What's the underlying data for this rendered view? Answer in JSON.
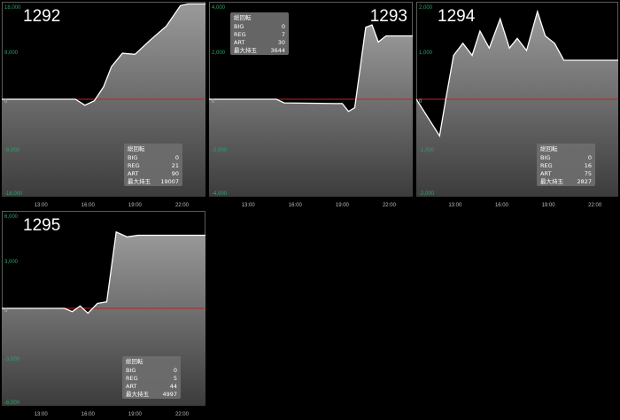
{
  "chart_data": [
    {
      "type": "area",
      "title": "1292",
      "x_ticks": [
        "13:00",
        "16:00",
        "19:00",
        "22:00"
      ],
      "x_tick_values": [
        13,
        16,
        19,
        22
      ],
      "xlim": [
        10.5,
        23.5
      ],
      "ylim": [
        -18000,
        18000
      ],
      "y_ticks": [
        18000,
        9000,
        0,
        -9000,
        -18000
      ],
      "y_tick_labels": [
        "18,000",
        "9,000",
        "0",
        "-9,000",
        "-18,000"
      ],
      "x": [
        10.5,
        15.2,
        15.8,
        16.4,
        17.0,
        17.5,
        18.2,
        19.0,
        20.0,
        21.0,
        21.9,
        22.4,
        23.5
      ],
      "y": [
        0,
        0,
        -1100,
        -300,
        2300,
        6000,
        8500,
        8300,
        11000,
        13500,
        17300,
        17600,
        17600
      ],
      "stats": {
        "heading": "総回転",
        "rows": [
          [
            "BIG",
            "0"
          ],
          [
            "REG",
            "21"
          ],
          [
            "ART",
            "90"
          ],
          [
            "最大持玉",
            "19007"
          ]
        ]
      }
    },
    {
      "type": "area",
      "title": "1293",
      "x_ticks": [
        "13:00",
        "16:00",
        "19:00",
        "22:00"
      ],
      "x_tick_values": [
        13,
        16,
        19,
        22
      ],
      "xlim": [
        10.5,
        23.5
      ],
      "ylim": [
        -4000,
        4000
      ],
      "y_ticks": [
        4000,
        2000,
        0,
        -2000,
        -4000
      ],
      "y_tick_labels": [
        "4,000",
        "2,000",
        "0",
        "-2,000",
        "-4,000"
      ],
      "x": [
        10.5,
        14.8,
        15.3,
        19.0,
        19.4,
        19.8,
        20.5,
        20.9,
        21.3,
        21.8,
        22.4,
        23.5
      ],
      "y": [
        0,
        0,
        -150,
        -180,
        -500,
        -350,
        2950,
        3050,
        2350,
        2600,
        2600,
        2600
      ],
      "stats": {
        "heading": "総回転",
        "rows": [
          [
            "BIG",
            "0"
          ],
          [
            "REG",
            "7"
          ],
          [
            "ART",
            "30"
          ],
          [
            "最大持玉",
            "3644"
          ]
        ]
      }
    },
    {
      "type": "area",
      "title": "1294",
      "x_ticks": [
        "13:00",
        "16:00",
        "19:00",
        "22:00"
      ],
      "x_tick_values": [
        13,
        16,
        19,
        22
      ],
      "xlim": [
        10.5,
        23.5
      ],
      "ylim": [
        -2000,
        2000
      ],
      "y_ticks": [
        2000,
        1000,
        0,
        -1000,
        -2000
      ],
      "y_tick_labels": [
        "2,000",
        "1,000",
        "0",
        "-1,000",
        "-2,000"
      ],
      "x": [
        10.5,
        12.0,
        12.4,
        12.9,
        13.5,
        14.1,
        14.6,
        15.2,
        15.9,
        16.5,
        17.0,
        17.6,
        18.3,
        18.8,
        19.4,
        20.0,
        23.5
      ],
      "y": [
        0,
        -750,
        0,
        900,
        1150,
        900,
        1400,
        1050,
        1650,
        1050,
        1250,
        1000,
        1800,
        1300,
        1150,
        800,
        800
      ],
      "stats": {
        "heading": "総回転",
        "rows": [
          [
            "BIG",
            "0"
          ],
          [
            "REG",
            "16"
          ],
          [
            "ART",
            "75"
          ],
          [
            "最大持玉",
            "2827"
          ]
        ]
      }
    },
    {
      "type": "area",
      "title": "1295",
      "x_ticks": [
        "13:00",
        "16:00",
        "19:00",
        "22:00"
      ],
      "x_tick_values": [
        13,
        16,
        19,
        22
      ],
      "xlim": [
        10.5,
        23.5
      ],
      "ylim": [
        -6000,
        6000
      ],
      "y_ticks": [
        6000,
        3000,
        0,
        -3000,
        -6000
      ],
      "y_tick_labels": [
        "6,000",
        "3,000",
        "0",
        "-3,000",
        "-6,000"
      ],
      "x": [
        10.5,
        14.5,
        15.0,
        15.5,
        16.0,
        16.6,
        17.2,
        17.8,
        18.5,
        19.2,
        20.0,
        23.5
      ],
      "y": [
        0,
        0,
        -200,
        150,
        -300,
        300,
        400,
        4700,
        4400,
        4500,
        4500,
        4500
      ],
      "stats": {
        "heading": "総回転",
        "rows": [
          [
            "BIG",
            "0"
          ],
          [
            "REG",
            "5"
          ],
          [
            "ART",
            "44"
          ],
          [
            "最大持玉",
            "4997"
          ]
        ]
      }
    }
  ]
}
